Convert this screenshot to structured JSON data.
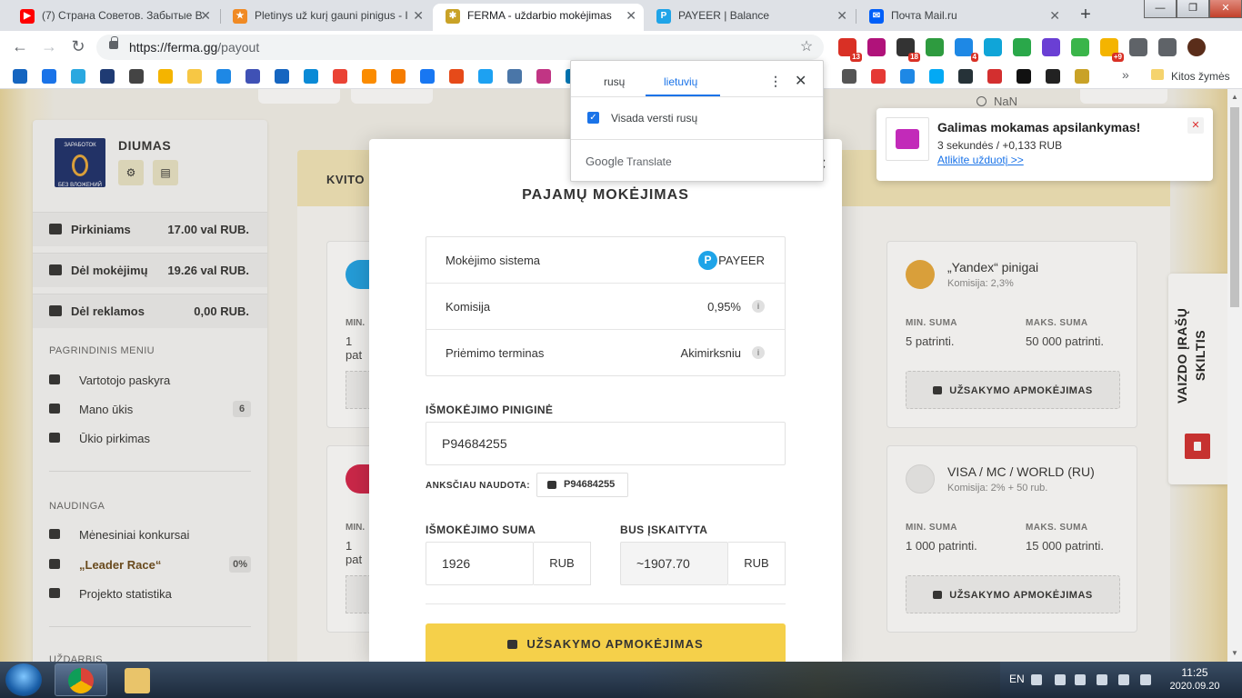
{
  "browser": {
    "tabs": [
      {
        "label": "(7) Страна Советов. Забытые В",
        "favicon": "youtube-icon",
        "color": "#ff0000",
        "active": false
      },
      {
        "label": "Pletinys už kurį gauni pinigus - I",
        "favicon": "star-icon",
        "color": "#f08a24",
        "active": false
      },
      {
        "label": "FERMA - uždarbio mokėjimas",
        "favicon": "wheat-icon",
        "color": "#c9a227",
        "active": true
      },
      {
        "label": "PAYEER | Balance",
        "favicon": "payeer-icon",
        "color": "#1fa4e8",
        "active": false
      },
      {
        "label": "Почта Mail.ru",
        "favicon": "mail-icon",
        "color": "#005ff9",
        "active": false
      }
    ],
    "url_host": "https://ferma.gg",
    "url_path": "/payout",
    "extensions": [
      {
        "name": "gmail-icon",
        "color": "#d93025",
        "badge": "13"
      },
      {
        "name": "se-icon",
        "color": "#b0127a",
        "badge": ""
      },
      {
        "name": "calendar-icon",
        "color": "#333333",
        "badge": "18"
      },
      {
        "name": "ruble-icon",
        "color": "#2e9b3f",
        "badge": ""
      },
      {
        "name": "ps-icon",
        "color": "#1e88e5",
        "badge": "4"
      },
      {
        "name": "check-icon",
        "color": "#10a5d8",
        "badge": ""
      },
      {
        "name": "star-ext-icon",
        "color": "#2aa84a",
        "badge": ""
      },
      {
        "name": "cross-ext-icon",
        "color": "#6a3fd4",
        "badge": ""
      },
      {
        "name": "circle-ext-icon",
        "color": "#3ab54a",
        "badge": ""
      },
      {
        "name": "sun-ext-icon",
        "color": "#f4b400",
        "badge": "+9"
      },
      {
        "name": "puzzle-icon",
        "color": "#5f6368",
        "badge": ""
      },
      {
        "name": "media-icon",
        "color": "#5f6368",
        "badge": ""
      },
      {
        "name": "profile-avatar-icon",
        "color": "#5a2d1a",
        "badge": ""
      }
    ],
    "bookmarks_more": "»",
    "bookmarks_folder": "Kitos žymės"
  },
  "site": {
    "clock_value": "NaN",
    "user": {
      "name": "DIUMAS",
      "avatar_text_top": "ЗАРАБОТОК",
      "avatar_text_bottom": "БЕЗ ВЛОЖЕНИЙ"
    },
    "balances": [
      {
        "label": "Pirkiniams",
        "value": "17.00 val RUB."
      },
      {
        "label": "Dėl mokėjimų",
        "value": "19.26 val RUB."
      },
      {
        "label": "Dėl reklamos",
        "value": "0,00 RUB."
      }
    ],
    "main_menu_title": "PAGRINDINIS MENIU",
    "main_menu": [
      {
        "label": "Vartotojo paskyra",
        "count": ""
      },
      {
        "label": "Mano ūkis",
        "count": "6"
      },
      {
        "label": "Ūkio pirkimas",
        "count": ""
      }
    ],
    "useful_title": "NAUDINGA",
    "useful_menu": [
      {
        "label": "Mėnesiniai konkursai",
        "count": ""
      },
      {
        "label": "„Leader Race“",
        "count": "0%"
      },
      {
        "label": "Projekto statistika",
        "count": ""
      }
    ],
    "cut_section_title": "UŽDARBIS",
    "header_strip": "KVITO",
    "partial_cards": [
      {
        "min_label": "MIN.",
        "min_value": "1 pat"
      },
      {
        "min_label": "MIN.",
        "min_value": "1 pat"
      }
    ],
    "cards": [
      {
        "title": "„Yandex“ pinigai",
        "sub": "Komisija: 2,3%",
        "min_label": "MIN. SUMA",
        "min_value": "5 patrinti.",
        "max_label": "MAKS. SUMA",
        "max_value": "50 000 patrinti.",
        "button": "UŽSAKYMO APMOKĖJIMAS",
        "icon_color": "#e8a93a"
      },
      {
        "title": "VISA / MC / WORLD (RU)",
        "sub": "Komisija: 2% + 50 rub.",
        "min_label": "MIN. SUMA",
        "min_value": "1 000 patrinti.",
        "max_label": "MAKS. SUMA",
        "max_value": "15 000 patrinti.",
        "button": "UŽSAKYMO APMOKĖJIMAS",
        "icon_color": "#e6e6e6"
      }
    ],
    "video_tab": "VAIZDO ĮRAŠŲ SKILTIS"
  },
  "modal": {
    "title": "PAJAMŲ MOKĖJIMAS",
    "info": [
      {
        "label": "Mokėjimo sistema",
        "value": "PAYEER"
      },
      {
        "label": "Komisija",
        "value": "0,95%"
      },
      {
        "label": "Priėmimo terminas",
        "value": "Akimirksniu"
      }
    ],
    "wallet_label": "IŠMOKĖJIMO PINIGINĖ",
    "wallet_value": "P94684255",
    "prev_label": "ANKSČIAU NAUDOTA:",
    "prev_value": "P94684255",
    "amount_label": "IŠMOKĖJIMO SUMA",
    "amount_value": "1926",
    "amount_unit": "RUB",
    "credited_label": "BUS ĮSKAITYTA",
    "credited_value": "~1907.70",
    "credited_unit": "RUB",
    "pay_button": "UŽSAKYMO APMOKĖJIMAS",
    "payeer_logo_letter": "P",
    "hint_icon": "i"
  },
  "translate_popup": {
    "tab_source": "rusų",
    "tab_target": "lietuvių",
    "always_translate": "Visada versti rusų",
    "brand_google": "Google",
    "brand_translate": "Translate"
  },
  "notification": {
    "title": "Galimas mokamas apsilankymas!",
    "text": "3 sekundės / +0,133 RUB",
    "link": "Atlikite užduotį >>"
  },
  "taskbar": {
    "lang": "EN",
    "time": "11:25",
    "date": "2020.09.20"
  }
}
